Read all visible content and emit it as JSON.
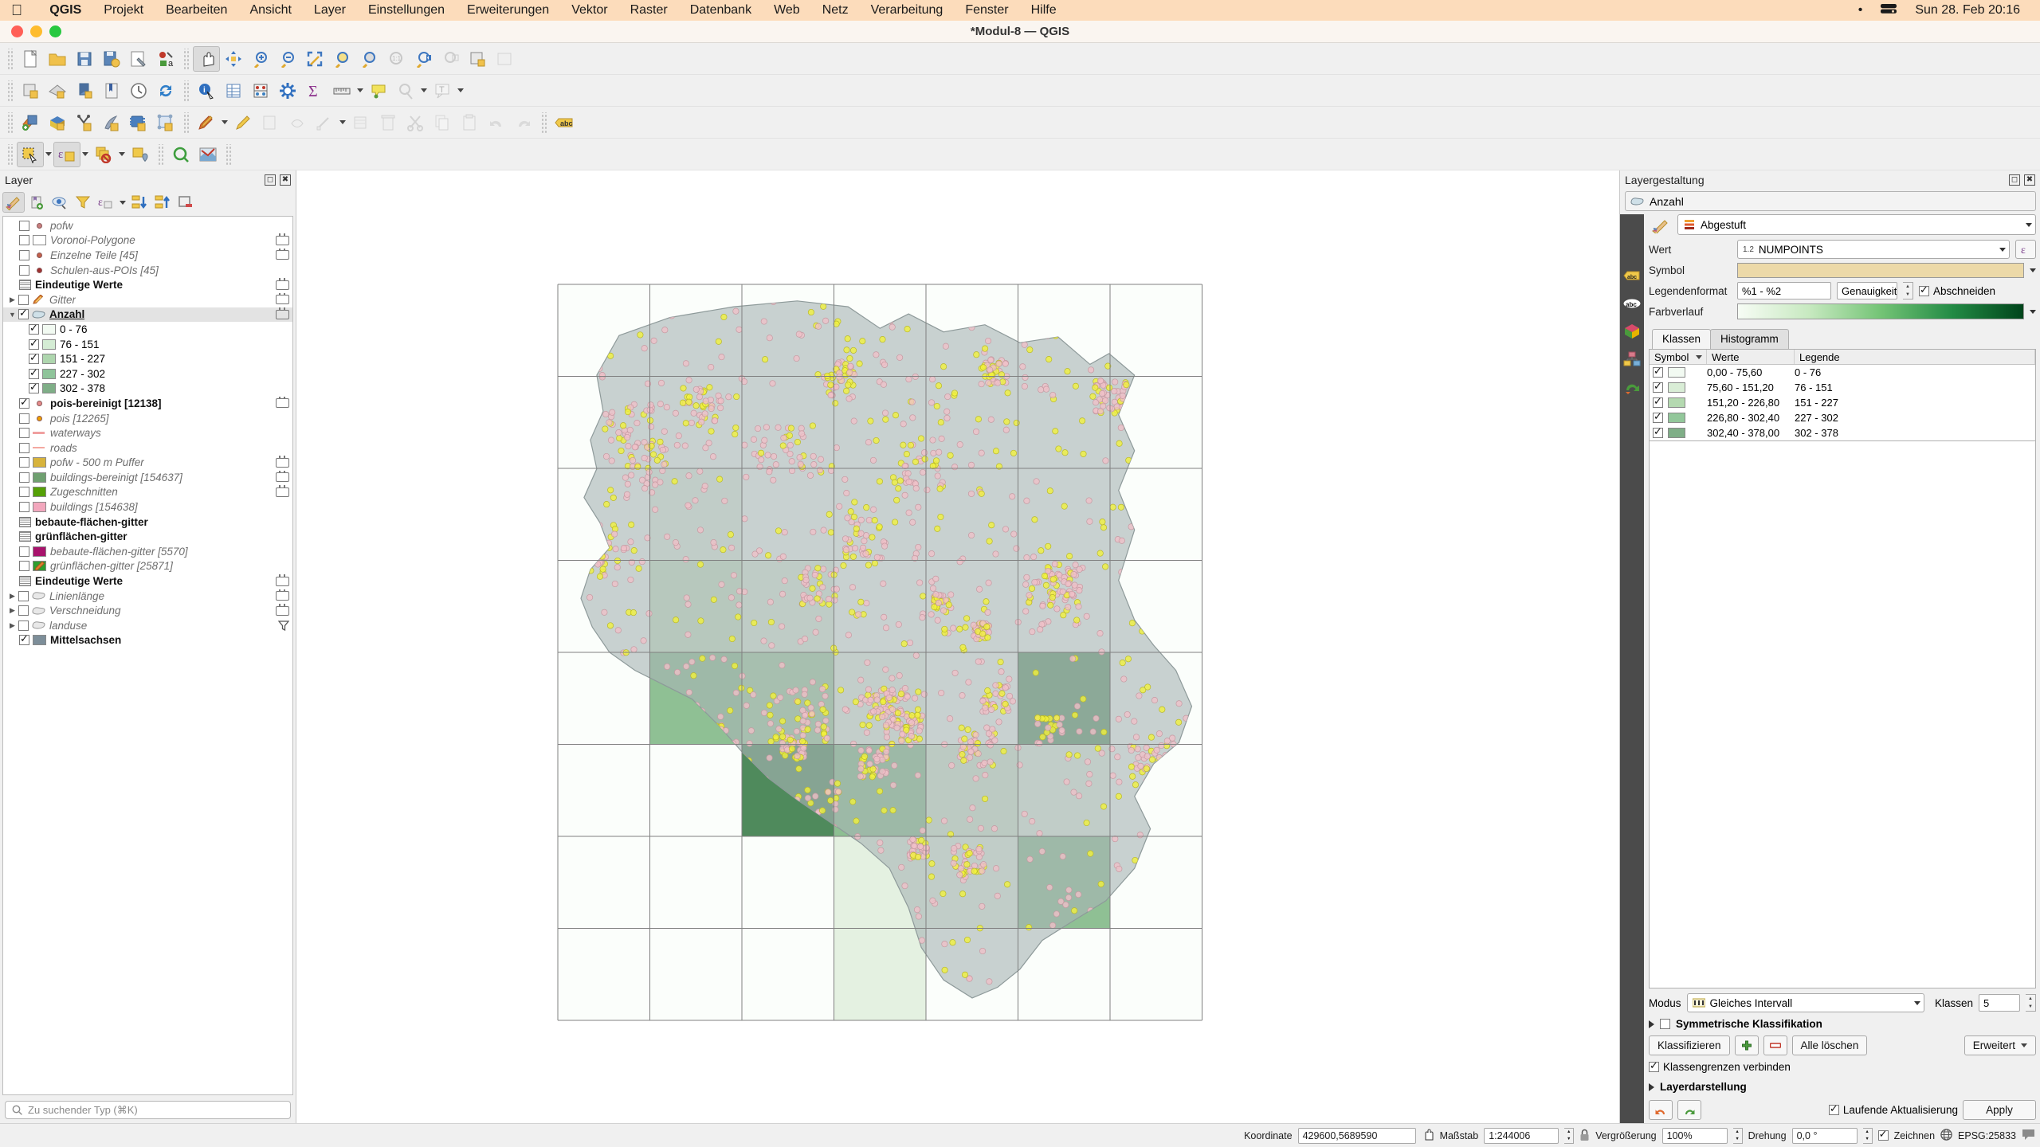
{
  "macbar": {
    "apple_icon": "apple-icon",
    "menus": [
      "QGIS",
      "Projekt",
      "Bearbeiten",
      "Ansicht",
      "Layer",
      "Einstellungen",
      "Erweiterungen",
      "Vektor",
      "Raster",
      "Datenbank",
      "Web",
      "Netz",
      "Verarbeitung",
      "Fenster",
      "Hilfe"
    ],
    "tray_dot": "•",
    "tray_battery_icon": "battery-icon",
    "clock": "Sun 28. Feb  20:16"
  },
  "window": {
    "title": "*Modul-8 — QGIS"
  },
  "toolbars": {
    "row1": [
      "new-project-icon",
      "open-project-icon",
      "save-project-icon",
      "save-project-as-icon",
      "project-properties-icon",
      "style-manager-icon",
      "pan-map-icon",
      "pan-to-selection-icon",
      "zoom-in-icon",
      "zoom-out-icon",
      "zoom-full-icon",
      "zoom-to-selection-icon",
      "zoom-to-layer-icon",
      "zoom-native-icon",
      "zoom-last-icon",
      "zoom-next-icon",
      "new-map-view-icon"
    ],
    "row2": [
      "new-3d-map-view-icon",
      "new-print-layout-icon",
      "new-report-icon",
      "layout-manager-icon",
      "temporal-controller-icon",
      "refresh-icon",
      "identify-features-icon",
      "open-attribute-table-icon",
      "field-calculator-icon",
      "processing-toolbox-icon",
      "statistical-summary-icon",
      "measure-line-icon",
      "map-tips-icon",
      "select-by-radius-icon",
      "text-annotation-icon"
    ],
    "row3": [
      "add-vector-layer-icon",
      "add-raster-layer-icon",
      "add-delimited-text-layer-icon",
      "add-spatialite-layer-icon",
      "add-postgis-layer-icon",
      "add-virtual-layer-icon",
      "current-edits-icon",
      "toggle-editing-icon",
      "save-layer-edits-icon",
      "add-feature-icon",
      "vertex-tool-icon",
      "modify-attributes-icon",
      "delete-selected-icon",
      "cut-features-icon",
      "copy-features-icon",
      "paste-features-icon",
      "undo-icon",
      "redo-icon",
      "label-toolbar-icon"
    ],
    "row4": [
      "select-features-icon",
      "select-by-expression-icon",
      "deselect-features-icon",
      "select-value-icon",
      "zoom-to-selected-icon",
      "open-attribute-form-icon"
    ]
  },
  "left_panel": {
    "title": "Layer",
    "float_icon": "undock-icon",
    "close_icon": "close-icon",
    "tools": [
      "open-layer-styling-panel-icon",
      "add-group-icon",
      "manage-map-themes-icon",
      "filter-legend-icon",
      "filter-legend-expression-icon",
      "expand-all-icon",
      "collapse-all-icon",
      "remove-layer-icon"
    ],
    "layers": [
      {
        "name": "pofw",
        "style": "italic",
        "checked": false,
        "symbol": "point",
        "color": "#c97f7f",
        "indent": 1,
        "expander": false,
        "chip": false
      },
      {
        "name": "Voronoi-Polygone",
        "style": "italic",
        "checked": false,
        "symbol": "swatch",
        "color": "#ffffff",
        "indent": 1,
        "expander": false,
        "chip": true
      },
      {
        "name": "Einzelne Teile [45]",
        "style": "italic",
        "checked": false,
        "symbol": "point",
        "color": "#c4604a",
        "indent": 1,
        "expander": false,
        "chip": true
      },
      {
        "name": "Schulen-aus-POIs [45]",
        "style": "italic",
        "checked": false,
        "symbol": "point",
        "color": "#a03030",
        "indent": 1,
        "expander": false,
        "chip": false
      },
      {
        "name": "Eindeutige Werte",
        "style": "bold",
        "checked": null,
        "symbol": "group",
        "color": "",
        "indent": 1,
        "expander": false,
        "chip": true
      },
      {
        "name": "Gitter",
        "style": "italic",
        "checked": false,
        "symbol": "pencil-poly",
        "color": "",
        "indent": 0,
        "expander": true,
        "chip": true
      },
      {
        "name": "Anzahl",
        "style": "bold-underline",
        "checked": true,
        "symbol": "poly",
        "color": "#cfe0e8",
        "indent": 0,
        "expander": true,
        "chip": true,
        "selected": true
      }
    ],
    "anzahl_classes": [
      {
        "label": "0 - 76",
        "color": "#f2faf2",
        "checked": true
      },
      {
        "label": "76 - 151",
        "color": "#d4ecd4",
        "checked": true
      },
      {
        "label": "151 - 227",
        "color": "#aed6ae",
        "checked": true
      },
      {
        "label": "227 - 302",
        "color": "#8fc49a",
        "checked": true
      },
      {
        "label": "302 - 378",
        "color": "#7fae87",
        "checked": true
      }
    ],
    "layers2": [
      {
        "name": "pois-bereinigt [12138]",
        "style": "bold",
        "checked": true,
        "symbol": "point",
        "color": "#e58b8b",
        "indent": 1,
        "expander": false,
        "chip": true
      },
      {
        "name": "pois [12265]",
        "style": "italic",
        "checked": false,
        "symbol": "point",
        "color": "#f0a000",
        "indent": 1,
        "expander": false,
        "chip": false
      },
      {
        "name": "waterways",
        "style": "italic",
        "checked": false,
        "symbol": "line",
        "color": "#f0a0a0",
        "indent": 1,
        "expander": false,
        "chip": false
      },
      {
        "name": "roads",
        "style": "italic",
        "checked": false,
        "symbol": "line",
        "color": "#f4a8a0",
        "indent": 1,
        "expander": false,
        "chip": false
      },
      {
        "name": "pofw - 500 m Puffer",
        "style": "italic",
        "checked": false,
        "symbol": "swatch",
        "color": "#d7b33c",
        "indent": 1,
        "expander": false,
        "chip": true
      },
      {
        "name": "buildings-bereinigt [154637]",
        "style": "italic",
        "checked": false,
        "symbol": "swatch",
        "color": "#6fa070",
        "indent": 1,
        "expander": false,
        "chip": true
      },
      {
        "name": "Zugeschnitten",
        "style": "italic",
        "checked": false,
        "symbol": "swatch",
        "color": "#55a006",
        "indent": 1,
        "expander": false,
        "chip": true
      },
      {
        "name": "buildings [154638]",
        "style": "italic",
        "checked": false,
        "symbol": "swatch",
        "color": "#f2a7bd",
        "indent": 1,
        "expander": false,
        "chip": false
      },
      {
        "name": "bebaute-flächen-gitter",
        "style": "bold",
        "checked": null,
        "symbol": "group",
        "color": "",
        "indent": 1,
        "expander": false,
        "chip": false
      },
      {
        "name": "grünflächen-gitter",
        "style": "bold",
        "checked": null,
        "symbol": "group",
        "color": "",
        "indent": 1,
        "expander": false,
        "chip": false
      },
      {
        "name": "bebaute-flächen-gitter [5570]",
        "style": "italic",
        "checked": false,
        "symbol": "swatch",
        "color": "#a8136c",
        "indent": 1,
        "expander": false,
        "chip": false
      },
      {
        "name": "grünflächen-gitter [25871]",
        "style": "italic",
        "checked": false,
        "symbol": "pencil-green",
        "color": "#2e9e2e",
        "indent": 1,
        "expander": false,
        "chip": false
      },
      {
        "name": "Eindeutige Werte",
        "style": "bold",
        "checked": null,
        "symbol": "group",
        "color": "",
        "indent": 1,
        "expander": false,
        "chip": true
      },
      {
        "name": "Linienlänge",
        "style": "italic",
        "checked": false,
        "symbol": "poly-grey",
        "color": "",
        "indent": 0,
        "expander": true,
        "chip": true
      },
      {
        "name": "Verschneidung",
        "style": "italic",
        "checked": false,
        "symbol": "poly-grey",
        "color": "",
        "indent": 0,
        "expander": true,
        "chip": true
      },
      {
        "name": "landuse",
        "style": "italic",
        "checked": false,
        "symbol": "poly-grey",
        "color": "",
        "indent": 0,
        "expander": true,
        "chip": false,
        "filter": true
      },
      {
        "name": "Mittelsachsen",
        "style": "bold",
        "checked": true,
        "symbol": "swatch",
        "color": "#7d8e99",
        "indent": 1,
        "expander": false,
        "chip": false
      }
    ],
    "search_placeholder": "Zu suchender Typ (⌘K)",
    "search_icon": "search-icon"
  },
  "right_panel": {
    "title": "Layergestaltung",
    "float_icon": "undock-icon",
    "close_icon": "close-icon",
    "layer_selector": "Anzahl",
    "layer_selector_icon": "polygon-layer-icon",
    "renderer": "Abgestuft",
    "renderer_icon": "graduated-icon",
    "brush_icon": "symbology-brush-icon",
    "side_icons": [
      "labels-icon",
      "masks-icon",
      "3d-view-icon",
      "diagrams-icon",
      "actions-icon"
    ],
    "fields": {
      "wert_label": "Wert",
      "wert_value": "NUMPOINTS",
      "wert_prefix": "1.2",
      "expression_icon": "expression-editor-icon",
      "symbol_label": "Symbol",
      "legend_label": "Legendenformat",
      "legend_format": "%1 - %2",
      "precision_value": "Genauigkeit (",
      "truncate_label": "Abschneiden",
      "truncate_checked": true,
      "ramp_label": "Farbverlauf",
      "ramp_colors": [
        "#f7fcf5",
        "#c7e9c0",
        "#74c476",
        "#238b45",
        "#00441b"
      ]
    },
    "tabs": [
      {
        "label": "Klassen",
        "active": true
      },
      {
        "label": "Histogramm",
        "active": false
      }
    ],
    "table_headers": [
      "Symbol",
      "Werte",
      "Legende"
    ],
    "classes": [
      {
        "checked": true,
        "color": "#f2faf2",
        "werte": "0,00 - 75,60",
        "legende": "0 - 76"
      },
      {
        "checked": true,
        "color": "#d9edd6",
        "werte": "75,60 - 151,20",
        "legende": "76 - 151"
      },
      {
        "checked": true,
        "color": "#b4d9b0",
        "werte": "151,20 - 226,80",
        "legende": "151 - 227"
      },
      {
        "checked": true,
        "color": "#92c79a",
        "werte": "226,80 - 302,40",
        "legende": "227 - 302"
      },
      {
        "checked": true,
        "color": "#7fae87",
        "werte": "302,40 - 378,00",
        "legende": "302 - 378"
      }
    ],
    "mode_label": "Modus",
    "mode_value": "Gleiches Intervall",
    "mode_icon": "interval-icon",
    "classes_label": "Klassen",
    "classes_count": "5",
    "symmetric_label": "Symmetrische Klassifikation",
    "symmetric_checked": false,
    "classify_button": "Klassifizieren",
    "add_class_icon": "add-icon",
    "delete_class_icon": "remove-icon",
    "delete_all_button": "Alle löschen",
    "advanced_button": "Erweitert",
    "join_label": "Klassengrenzen verbinden",
    "join_checked": true,
    "layer_rendering_label": "Layerdarstellung",
    "undo_icon": "undo-icon",
    "redo_icon": "redo-icon",
    "live_update_label": "Laufende Aktualisierung",
    "live_update_checked": true,
    "apply_button": "Apply"
  },
  "status_bar": {
    "coord_label": "Koordinate",
    "coord_value": "429600,5689590",
    "coord_toggle_icon": "coordinate-capture-icon",
    "scale_label": "Maßstab",
    "scale_value": "1:244006",
    "lock_icon": "lock-scale-icon",
    "magnifier_label": "Vergrößerung",
    "magnifier_value": "100%",
    "rotation_label": "Drehung",
    "rotation_value": "0,0 °",
    "render_label": "Zeichnen",
    "render_checked": true,
    "crs_label": "EPSG:25833",
    "crs_icon": "globe-icon",
    "messages_icon": "messages-icon"
  },
  "map": {
    "grid_cols": 7,
    "grid_rows": 7,
    "cell_colors": [
      [
        "#fbfefb",
        "#fbfefb",
        "#fbfefb",
        "#fbfefb",
        "#fbfefb",
        "#fbfefb",
        "#fbfefb"
      ],
      [
        "#fbfefb",
        "#fbfefb",
        "#fbfefb",
        "#fbfefb",
        "#fbfefb",
        "#fbfefb",
        "#fbfefb"
      ],
      [
        "#fbfefb",
        "#e9f5e7",
        "#fbfefb",
        "#fbfefb",
        "#fbfefb",
        "#fbfefb",
        "#fbfefb"
      ],
      [
        "#fbfefb",
        "#cfe6cb",
        "#e4f1e1",
        "#fbfefb",
        "#fbfefb",
        "#fbfefb",
        "#fbfefb"
      ],
      [
        "#fbfefb",
        "#8fc094",
        "#a7cfa6",
        "#eef8ec",
        "#fbfefb",
        "#5f9669",
        "#fbfefb"
      ],
      [
        "#fbfefb",
        "#fbfefb",
        "#4f8a5c",
        "#8dbf92",
        "#dcecd8",
        "#e9f5e7",
        "#fbfefb"
      ],
      [
        "#fbfefb",
        "#fbfefb",
        "#fbfefb",
        "#e4f1e1",
        "#e9f5e7",
        "#8fc094",
        "#fbfefb"
      ],
      [
        "#fbfefb",
        "#fbfefb",
        "#fbfefb",
        "#e4f1e1",
        "#fbfefb",
        "#fbfefb",
        "#fbfefb"
      ]
    ],
    "region_fill": "#a8b5b5",
    "region_stroke": "#8e9a9a",
    "poi_color_pink": "#f0c0c8",
    "poi_color_yellow": "#f2f23a",
    "grid_line_color": "#808080"
  }
}
